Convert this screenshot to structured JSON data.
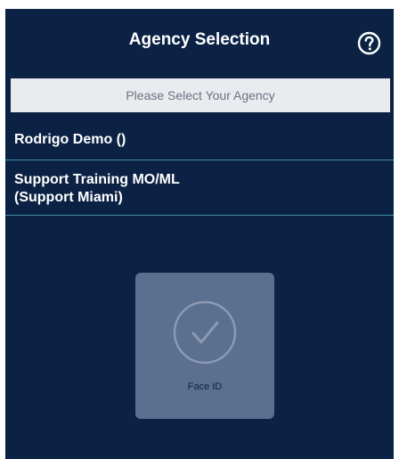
{
  "header": {
    "title": "Agency Selection",
    "help_icon": "help-circle-icon"
  },
  "banner": {
    "text": "Please Select Your Agency"
  },
  "agencies": [
    {
      "lines": [
        "Rodrigo Demo ()"
      ]
    },
    {
      "lines": [
        "Support Training MO/ML",
        "(Support Miami)"
      ]
    }
  ],
  "face_id": {
    "icon": "checkmark-circle-icon",
    "label": "Face ID"
  },
  "colors": {
    "background": "#0c2245",
    "banner": "#e9ecef",
    "divider": "#3e8fa3",
    "face_id_tile": "#5b6f8e"
  }
}
